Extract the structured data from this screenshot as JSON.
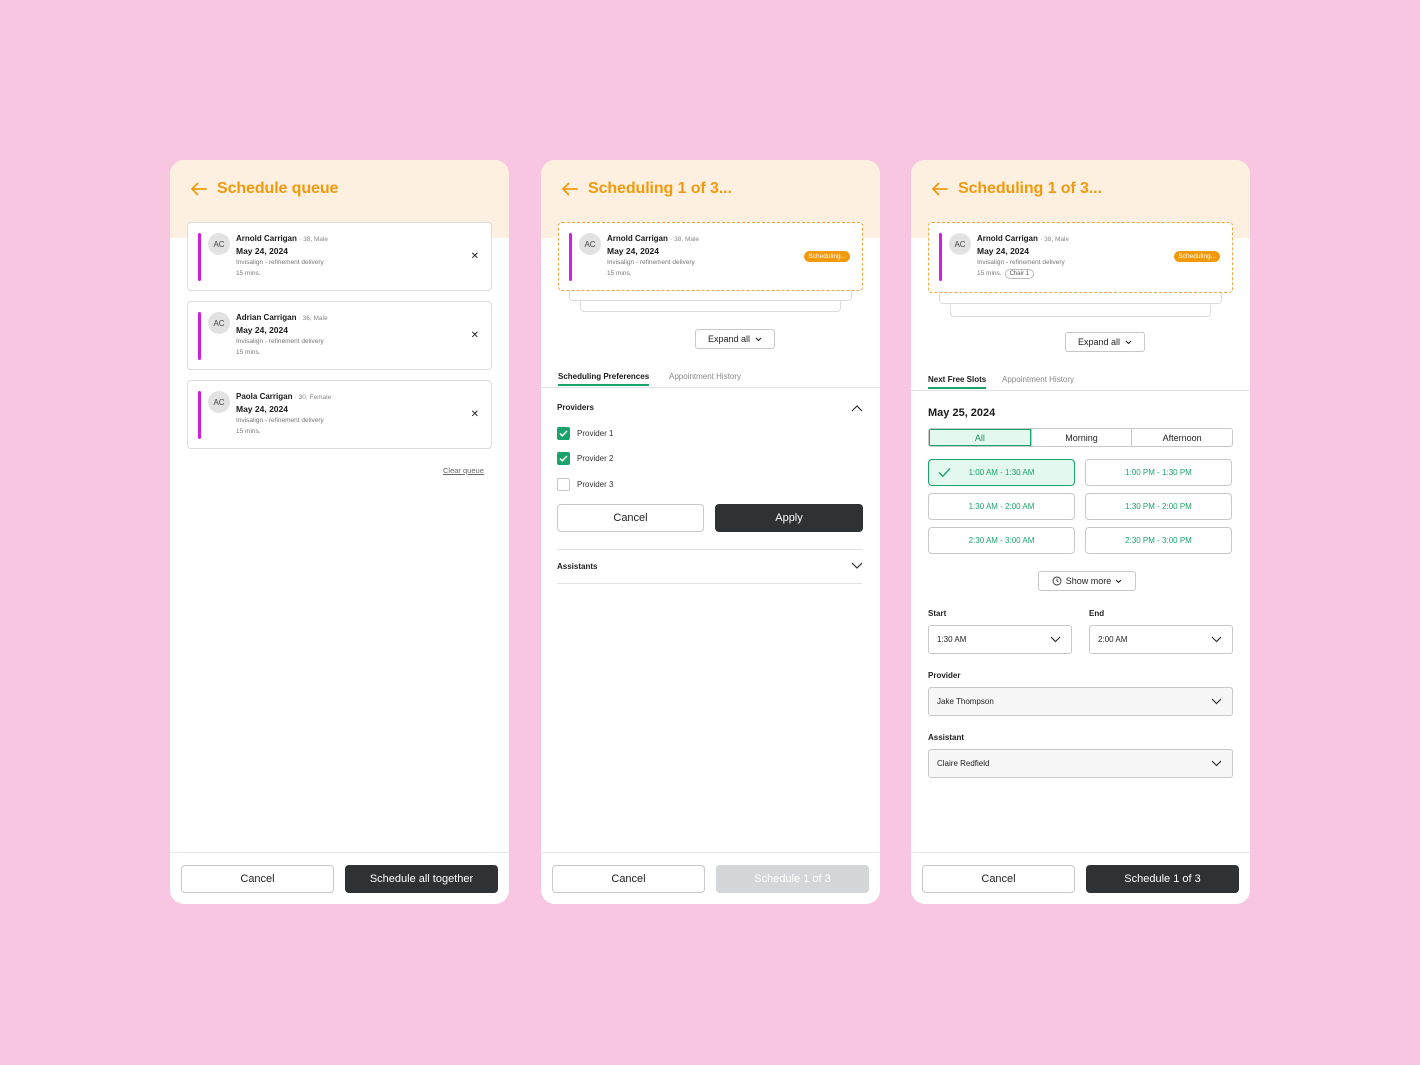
{
  "colors": {
    "background": "#f8c6e0",
    "accent": "#f29a0e",
    "header_bg": "#fdf0e1",
    "success": "#1aa36b",
    "patient_bar": "#d11ddc",
    "dark_button": "#2f3235"
  },
  "panel1": {
    "title": "Schedule queue",
    "cards": [
      {
        "initials": "AC",
        "name": "Arnold Carrigan",
        "meta": "· 38, Male",
        "date": "May 24, 2024",
        "procedure": "Invisalign - refinement delivery",
        "duration": "15 mins."
      },
      {
        "initials": "AC",
        "name": "Adrian Carrigan",
        "meta": "· 36, Male",
        "date": "May 24, 2024",
        "procedure": "Invisalign - refinement delivery",
        "duration": "15 mins."
      },
      {
        "initials": "AC",
        "name": "Paola Carrigan",
        "meta": "· 30, Female",
        "date": "May 24, 2024",
        "procedure": "Invisalign - refinement delivery",
        "duration": "15 mins."
      }
    ],
    "clear_queue": "Clear queue",
    "cancel": "Cancel",
    "primary": "Schedule all together"
  },
  "panel2": {
    "title": "Scheduling 1 of 3...",
    "card": {
      "initials": "AC",
      "name": "Arnold Carrigan",
      "meta": "· 38, Male",
      "date": "May 24, 2024",
      "procedure": "Invisalign - refinement delivery",
      "duration": "15 mins.",
      "status": "Scheduling..."
    },
    "expand_all": "Expand all",
    "tabs": [
      "Scheduling Preferences",
      "Appointment History"
    ],
    "providers_label": "Providers",
    "providers": [
      {
        "label": "Provider 1",
        "checked": true
      },
      {
        "label": "Provider 2",
        "checked": true
      },
      {
        "label": "Provider 3",
        "checked": false
      }
    ],
    "cancel_inline": "Cancel",
    "apply": "Apply",
    "assistants_label": "Assistants",
    "cancel": "Cancel",
    "primary": "Schedule 1 of 3"
  },
  "panel3": {
    "title": "Scheduling 1 of 3...",
    "card": {
      "initials": "AC",
      "name": "Arnold Carrigan",
      "meta": "· 38, Male",
      "date": "May 24, 2024",
      "procedure": "Invisalign - refinement delivery",
      "duration": "15 mins.",
      "chair": "Chair 1",
      "status": "Scheduling..."
    },
    "expand_all": "Expand all",
    "tabs": [
      "Next Free Slots",
      "Appointment History"
    ],
    "date": "May 25, 2024",
    "filters": [
      "All",
      "Morning",
      "Afternoon"
    ],
    "selected_filter": "All",
    "slots": [
      "1:00 AM - 1:30 AM",
      "1:00 PM - 1:30 PM",
      "1:30 AM - 2:00 AM",
      "1:30 PM - 2:00 PM",
      "2:30 AM - 3:00 AM",
      "2:30 PM - 3:00 PM"
    ],
    "selected_slot": "1:00 AM - 1:30 AM",
    "show_more": "Show more",
    "start_label": "Start",
    "start_value": "1:30 AM",
    "end_label": "End",
    "end_value": "2:00 AM",
    "provider_label": "Provider",
    "provider_value": "Jake Thompson",
    "assistant_label": "Assistant",
    "assistant_value": "Claire Redfield",
    "cancel": "Cancel",
    "primary": "Schedule 1 of 3"
  }
}
